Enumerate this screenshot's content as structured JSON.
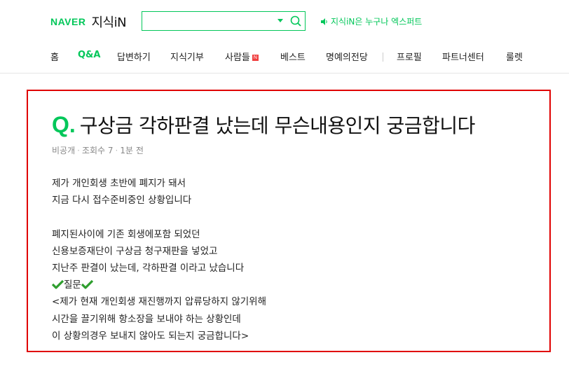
{
  "header": {
    "logo_brand": "NAVER",
    "logo_service": "지식iN",
    "search_value": "",
    "promo_text": "지식iN은 누구나 엑스퍼트"
  },
  "nav": {
    "items": [
      {
        "label": "홈"
      },
      {
        "label": "Q&A",
        "active": true
      },
      {
        "label": "답변하기"
      },
      {
        "label": "지식기부"
      },
      {
        "label": "사람들",
        "badge": "N"
      },
      {
        "label": "베스트"
      },
      {
        "label": "명예의전당"
      },
      {
        "label": "프로필"
      },
      {
        "label": "파트너센터"
      },
      {
        "label": "룰렛"
      }
    ]
  },
  "question": {
    "mark": "Q.",
    "title": "구상금 각하판결 났는데 무슨내용인지 궁금합니다",
    "author": "비공개",
    "views": "조회수 7",
    "time": "1분 전",
    "lines": [
      "제가 개인회생 초반에 폐지가 돼서",
      "지금 다시 접수준비중인 상황입니다",
      "",
      "폐지된사이에 기존 회생에포함 되었던",
      "신용보증재단이 구상금 청구재판을 넣었고",
      "지난주 판결이 났는데, 각하판결 이라고 났습니다",
      "질문",
      "<제가 현재 개인회생 재진행까지 압류당하지 않기위해",
      "시간을 끌기위해 항소장을 보내야 하는 상황인데",
      "이 상황의경우 보내지 않아도 되는지 궁금합니다>"
    ]
  },
  "colors": {
    "accent": "#03c75a",
    "highlight_border": "#e00000"
  }
}
